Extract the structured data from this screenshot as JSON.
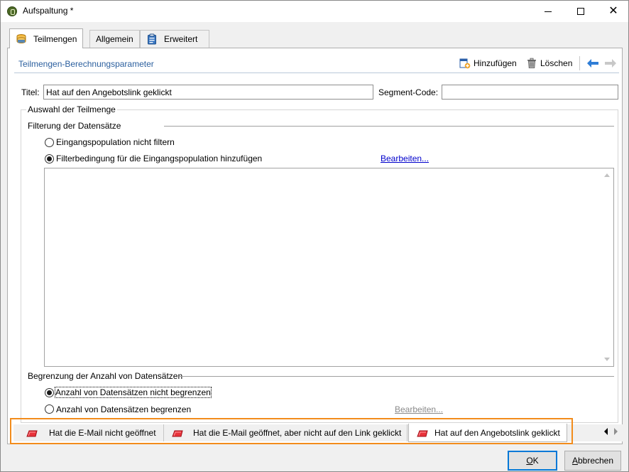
{
  "window": {
    "title": "Aufspaltung *",
    "controls": {
      "minimize": "minimize",
      "maximize": "maximize",
      "close": "✕"
    }
  },
  "tabs": [
    {
      "label": "Teilmengen",
      "icon": "database-icon",
      "active": true
    },
    {
      "label": "Allgemein",
      "active": false
    },
    {
      "label": "Erweitert",
      "icon": "clipboard-icon",
      "active": false
    }
  ],
  "toolbar": {
    "title": "Teilmengen-Berechnungsparameter",
    "add_label": "Hinzufügen",
    "delete_label": "Löschen"
  },
  "fields": {
    "title_label": "Titel:",
    "title_value": "Hat auf den Angebotslink geklickt",
    "segment_label": "Segment-Code:",
    "segment_value": ""
  },
  "subset": {
    "group_title": "Auswahl der Teilmenge",
    "filter_section": "Filterung der Datensätze",
    "radio_no_filter": "Eingangspopulation nicht filtern",
    "radio_add_filter": "Filterbedingung für die Eingangspopulation hinzufügen",
    "edit_link": "Bearbeiten...",
    "filter_text": "",
    "limit_section": "Begrenzung der Anzahl von Datensätzen",
    "radio_no_limit": "Anzahl von Datensätzen nicht begrenzen",
    "radio_limit": "Anzahl von Datensätzen begrenzen",
    "limit_edit_link": "Bearbeiten..."
  },
  "subset_tabs": [
    {
      "label": "Hat die E-Mail nicht geöffnet",
      "active": false
    },
    {
      "label": "Hat die E-Mail geöffnet, aber nicht auf den Link geklickt",
      "active": false
    },
    {
      "label": "Hat auf den Angebotslink geklickt",
      "active": true
    }
  ],
  "buttons": {
    "ok_u": "O",
    "ok_rest": "K",
    "cancel_u": "A",
    "cancel_rest": "bbrechen"
  },
  "colors": {
    "highlight": "#f28c1c",
    "accent": "#2b5f9e",
    "link": "#0000cc"
  }
}
